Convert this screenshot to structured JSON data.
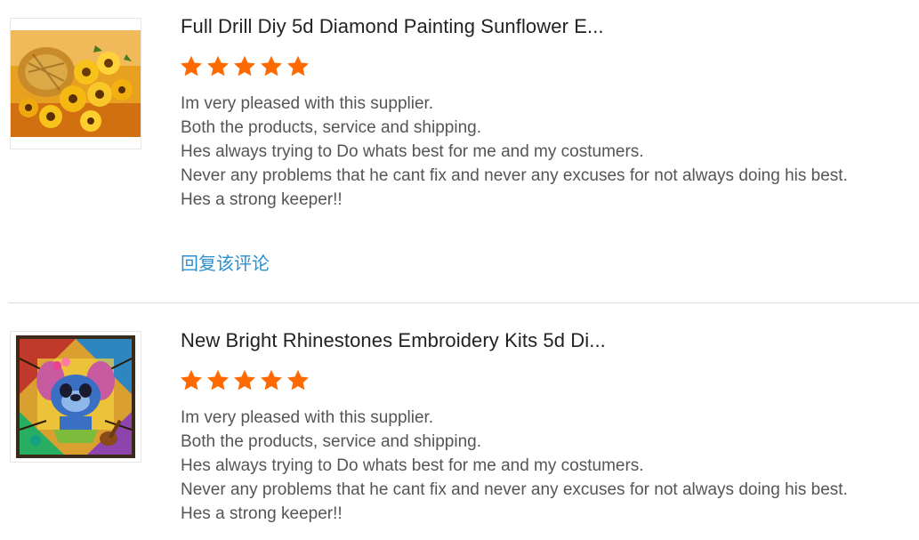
{
  "reviews": [
    {
      "product_title": "Full Drill Diy 5d Diamond Painting Sunflower E...",
      "thumbnail": "sunflower-basket-diamond-painting",
      "rating": 5,
      "rating_max": 5,
      "lines": [
        "Im very pleased with this supplier.",
        "Both the products, service and shipping.",
        "Hes always trying to Do whats best for me and my costumers.",
        "Never any problems that he cant fix and never any excuses for not always doing his best.",
        "Hes a strong keeper!!"
      ],
      "reply_label": "回复该评论"
    },
    {
      "product_title": "New Bright Rhinestones Embroidery Kits 5d Di...",
      "thumbnail": "stitch-stained-glass-diamond-painting",
      "rating": 5,
      "rating_max": 5,
      "lines": [
        "Im very pleased with this supplier.",
        "Both the products, service and shipping.",
        "Hes always trying to Do whats best for me and my costumers.",
        "Never any problems that he cant fix and never any excuses for not always doing his best.",
        "Hes a strong keeper!!"
      ]
    }
  ],
  "colors": {
    "star": "#ff6a00",
    "reply_link": "#2b8fcf",
    "title": "#222222",
    "body_text": "#555555",
    "divider": "#dddddd"
  }
}
